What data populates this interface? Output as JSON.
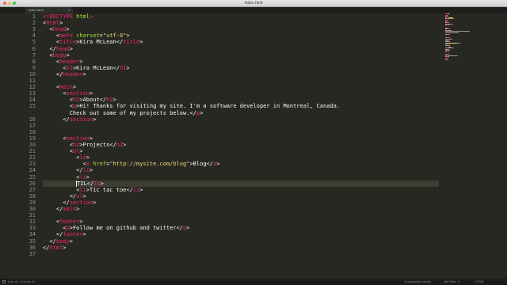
{
  "window": {
    "title": "Index.html"
  },
  "tabs": [
    {
      "label": "Index.html",
      "close": "✕"
    }
  ],
  "code_lines": [
    {
      "num": "1",
      "tokens": [
        {
          "t": "<!",
          "c": "tag"
        },
        {
          "t": "DOCTYPE",
          "c": "tag"
        },
        {
          "t": " html",
          "c": "attr"
        },
        {
          "t": ">",
          "c": "tag"
        }
      ]
    },
    {
      "num": "2",
      "tokens": [
        {
          "t": "<",
          "c": ""
        },
        {
          "t": "html",
          "c": "tag"
        },
        {
          "t": ">",
          "c": ""
        }
      ]
    },
    {
      "num": "3",
      "tokens": [
        {
          "t": "  <",
          "c": ""
        },
        {
          "t": "head",
          "c": "tag"
        },
        {
          "t": ">",
          "c": ""
        }
      ]
    },
    {
      "num": "4",
      "tokens": [
        {
          "t": "    <",
          "c": ""
        },
        {
          "t": "meta",
          "c": "tag"
        },
        {
          "t": " ",
          "c": ""
        },
        {
          "t": "charset",
          "c": "attr"
        },
        {
          "t": "=",
          "c": ""
        },
        {
          "t": "\"utf-8\"",
          "c": "str"
        },
        {
          "t": ">",
          "c": ""
        }
      ]
    },
    {
      "num": "5",
      "tokens": [
        {
          "t": "    <",
          "c": ""
        },
        {
          "t": "title",
          "c": "tag"
        },
        {
          "t": ">Kira McLean</",
          "c": ""
        },
        {
          "t": "title",
          "c": "tag"
        },
        {
          "t": ">",
          "c": ""
        }
      ]
    },
    {
      "num": "6",
      "tokens": [
        {
          "t": "  </",
          "c": ""
        },
        {
          "t": "head",
          "c": "tag"
        },
        {
          "t": ">",
          "c": ""
        }
      ]
    },
    {
      "num": "7",
      "tokens": [
        {
          "t": "  <",
          "c": ""
        },
        {
          "t": "body",
          "c": "tag"
        },
        {
          "t": ">",
          "c": ""
        }
      ]
    },
    {
      "num": "8",
      "tokens": [
        {
          "t": "    <",
          "c": ""
        },
        {
          "t": "header",
          "c": "tag"
        },
        {
          "t": ">",
          "c": ""
        }
      ]
    },
    {
      "num": "9",
      "tokens": [
        {
          "t": "      <",
          "c": ""
        },
        {
          "t": "h1",
          "c": "tag"
        },
        {
          "t": ">Kira McLean</",
          "c": ""
        },
        {
          "t": "h1",
          "c": "tag"
        },
        {
          "t": ">",
          "c": ""
        }
      ]
    },
    {
      "num": "10",
      "tokens": [
        {
          "t": "    </",
          "c": ""
        },
        {
          "t": "header",
          "c": "tag"
        },
        {
          "t": ">",
          "c": ""
        }
      ]
    },
    {
      "num": "11",
      "tokens": []
    },
    {
      "num": "12",
      "tokens": [
        {
          "t": "    <",
          "c": ""
        },
        {
          "t": "main",
          "c": "tag"
        },
        {
          "t": ">",
          "c": ""
        }
      ]
    },
    {
      "num": "13",
      "tokens": [
        {
          "t": "      <",
          "c": ""
        },
        {
          "t": "section",
          "c": "tag"
        },
        {
          "t": ">",
          "c": ""
        }
      ]
    },
    {
      "num": "14",
      "tokens": [
        {
          "t": "        <",
          "c": ""
        },
        {
          "t": "h2",
          "c": "tag"
        },
        {
          "t": ">About</",
          "c": ""
        },
        {
          "t": "h2",
          "c": "tag"
        },
        {
          "t": ">",
          "c": ""
        }
      ]
    },
    {
      "num": "15",
      "tokens": [
        {
          "t": "        <",
          "c": ""
        },
        {
          "t": "p",
          "c": "tag"
        },
        {
          "t": ">Hi! Thanks for visiting my site. I'm a software developer in Montreal, Canada.",
          "c": ""
        }
      ]
    },
    {
      "num": "",
      "tokens": [
        {
          "t": "        Check out some of my projects below.</",
          "c": ""
        },
        {
          "t": "p",
          "c": "tag"
        },
        {
          "t": ">",
          "c": ""
        }
      ]
    },
    {
      "num": "16",
      "tokens": [
        {
          "t": "      </",
          "c": ""
        },
        {
          "t": "section",
          "c": "tag"
        },
        {
          "t": ">",
          "c": ""
        }
      ]
    },
    {
      "num": "17",
      "tokens": []
    },
    {
      "num": "18",
      "tokens": []
    },
    {
      "num": "19",
      "tokens": [
        {
          "t": "      <",
          "c": ""
        },
        {
          "t": "section",
          "c": "tag"
        },
        {
          "t": ">",
          "c": ""
        }
      ]
    },
    {
      "num": "20",
      "tokens": [
        {
          "t": "        <",
          "c": ""
        },
        {
          "t": "h2",
          "c": "tag"
        },
        {
          "t": ">Projects</",
          "c": ""
        },
        {
          "t": "h2",
          "c": "tag"
        },
        {
          "t": ">",
          "c": ""
        }
      ]
    },
    {
      "num": "21",
      "tokens": [
        {
          "t": "        <",
          "c": ""
        },
        {
          "t": "ul",
          "c": "tag"
        },
        {
          "t": ">",
          "c": ""
        }
      ]
    },
    {
      "num": "22",
      "tokens": [
        {
          "t": "          <",
          "c": ""
        },
        {
          "t": "li",
          "c": "tag"
        },
        {
          "t": ">",
          "c": ""
        }
      ]
    },
    {
      "num": "23",
      "tokens": [
        {
          "t": "            <",
          "c": ""
        },
        {
          "t": "a",
          "c": "tag"
        },
        {
          "t": " ",
          "c": ""
        },
        {
          "t": "href",
          "c": "attr"
        },
        {
          "t": "=",
          "c": ""
        },
        {
          "t": "\"http://mysite.com/blog\"",
          "c": "str"
        },
        {
          "t": ">Blog</",
          "c": ""
        },
        {
          "t": "a",
          "c": "tag"
        },
        {
          "t": ">",
          "c": ""
        }
      ]
    },
    {
      "num": "24",
      "tokens": [
        {
          "t": "          </",
          "c": ""
        },
        {
          "t": "li",
          "c": "tag"
        },
        {
          "t": ">",
          "c": ""
        }
      ]
    },
    {
      "num": "25",
      "tokens": [
        {
          "t": "          <",
          "c": ""
        },
        {
          "t": "li",
          "c": "tag"
        },
        {
          "t": ">",
          "c": ""
        }
      ]
    },
    {
      "num": "26",
      "tokens": [
        {
          "t": "          ",
          "c": ""
        },
        {
          "t": "|",
          "c": "caret"
        },
        {
          "t": "TIL</",
          "c": ""
        },
        {
          "t": "li",
          "c": "tag"
        },
        {
          "t": ">",
          "c": ""
        }
      ],
      "current": true
    },
    {
      "num": "27",
      "tokens": [
        {
          "t": "          <",
          "c": ""
        },
        {
          "t": "li",
          "c": "tag"
        },
        {
          "t": ">Tic tac toe</",
          "c": ""
        },
        {
          "t": "li",
          "c": "tag"
        },
        {
          "t": ">",
          "c": ""
        }
      ]
    },
    {
      "num": "28",
      "tokens": [
        {
          "t": "        </",
          "c": ""
        },
        {
          "t": "ul",
          "c": "tag"
        },
        {
          "t": ">",
          "c": ""
        }
      ]
    },
    {
      "num": "29",
      "tokens": [
        {
          "t": "      </",
          "c": ""
        },
        {
          "t": "section",
          "c": "tag"
        },
        {
          "t": ">",
          "c": ""
        }
      ]
    },
    {
      "num": "30",
      "tokens": [
        {
          "t": "    </",
          "c": ""
        },
        {
          "t": "main",
          "c": "tag"
        },
        {
          "t": ">",
          "c": ""
        }
      ]
    },
    {
      "num": "31",
      "tokens": []
    },
    {
      "num": "32",
      "tokens": [
        {
          "t": "    <",
          "c": ""
        },
        {
          "t": "footer",
          "c": "tag"
        },
        {
          "t": ">",
          "c": ""
        }
      ]
    },
    {
      "num": "33",
      "tokens": [
        {
          "t": "      <",
          "c": ""
        },
        {
          "t": "p",
          "c": "tag"
        },
        {
          "t": ">Follow me on github and twitter</",
          "c": ""
        },
        {
          "t": "p",
          "c": "tag"
        },
        {
          "t": ">",
          "c": ""
        }
      ]
    },
    {
      "num": "34",
      "tokens": [
        {
          "t": "    </",
          "c": ""
        },
        {
          "t": "footer",
          "c": "tag"
        },
        {
          "t": ">",
          "c": ""
        }
      ]
    },
    {
      "num": "35",
      "tokens": [
        {
          "t": "  </",
          "c": ""
        },
        {
          "t": "body",
          "c": "tag"
        },
        {
          "t": ">",
          "c": ""
        }
      ]
    },
    {
      "num": "36",
      "tokens": [
        {
          "t": "</",
          "c": ""
        },
        {
          "t": "html",
          "c": "tag"
        },
        {
          "t": ">",
          "c": ""
        }
      ]
    },
    {
      "num": "37",
      "tokens": []
    }
  ],
  "statusbar": {
    "left": "Line 26, Column 11",
    "middle": "2 misspelled words",
    "spaces": "Tab Size: 2",
    "syntax": "HTML"
  },
  "colors": {
    "background": "#272822",
    "tag": "#f92672",
    "attribute": "#a6e22e",
    "string": "#e6db74",
    "text": "#f8f8f2",
    "gutter": "#8f908a"
  }
}
